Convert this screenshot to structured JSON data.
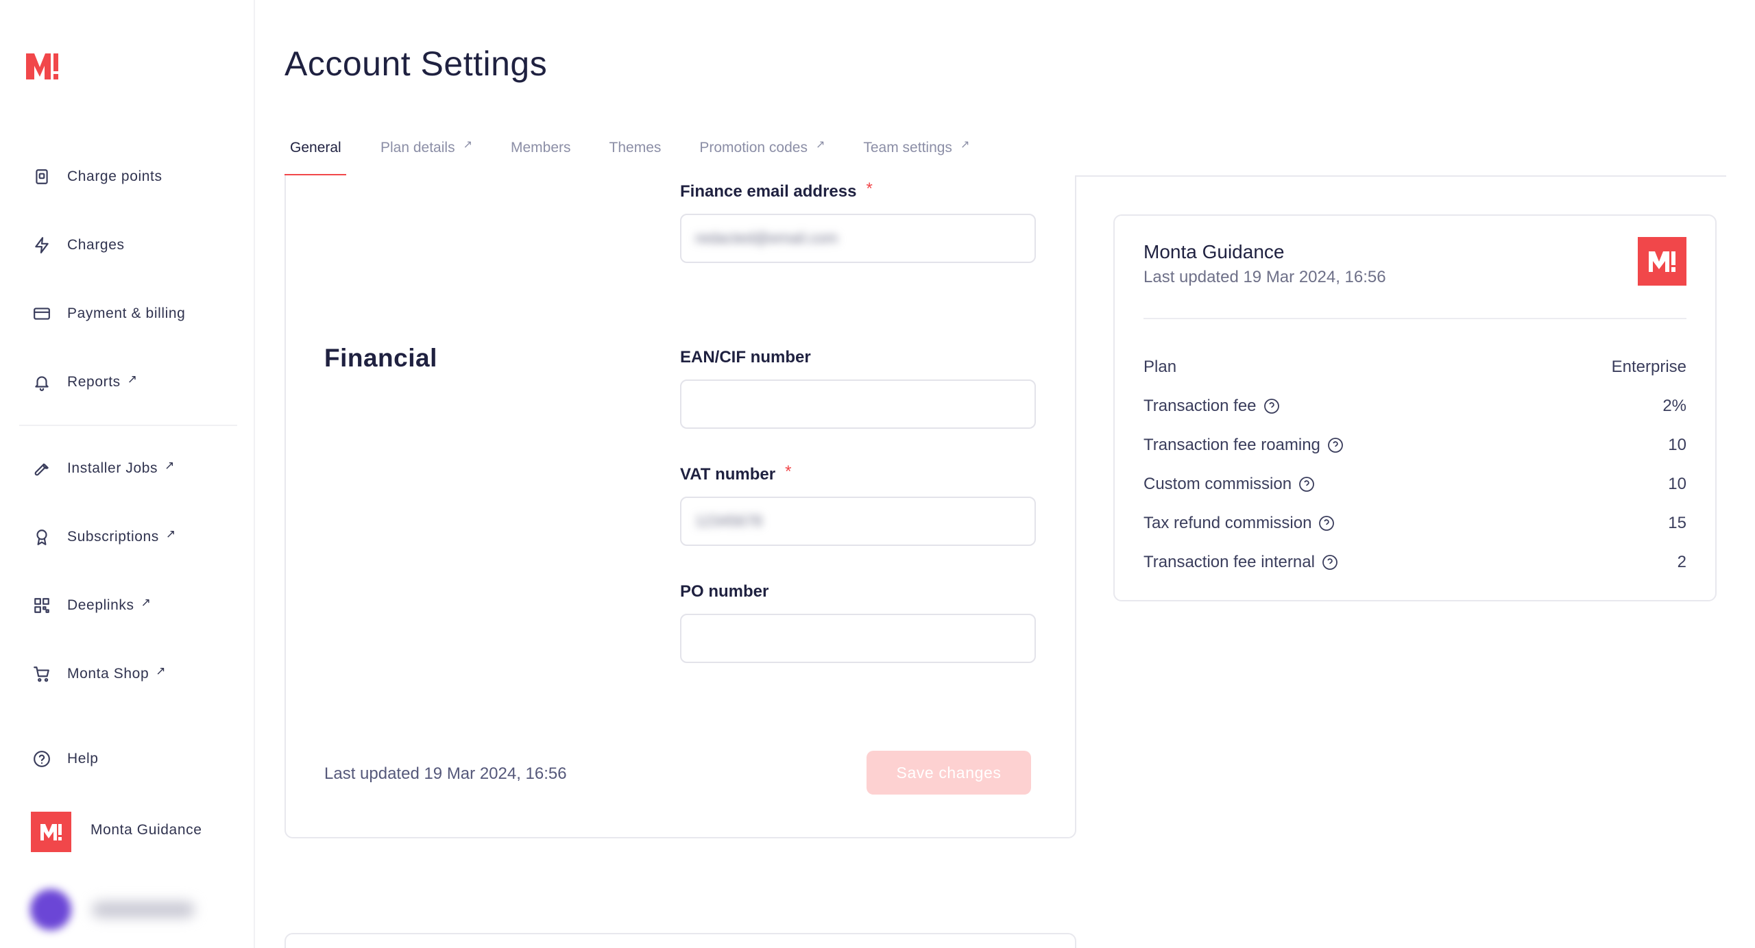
{
  "sidebar": {
    "logo": "monta-logo",
    "items": [
      {
        "label": "Charge points",
        "icon": "charge-point-icon",
        "external": false
      },
      {
        "label": "Charges",
        "icon": "lightning-icon",
        "external": false
      },
      {
        "label": "Payment & billing",
        "icon": "credit-card-icon",
        "external": false
      },
      {
        "label": "Reports",
        "icon": "bell-icon",
        "external": true
      },
      {
        "label": "Installer Jobs",
        "icon": "wrench-icon",
        "external": true
      },
      {
        "label": "Subscriptions",
        "icon": "award-icon",
        "external": true
      },
      {
        "label": "Deeplinks",
        "icon": "qr-code-icon",
        "external": true
      },
      {
        "label": "Monta Shop",
        "icon": "shopping-cart-icon",
        "external": true
      },
      {
        "label": "Help",
        "icon": "help-circle-icon",
        "external": false
      }
    ],
    "external_glyph": "↗",
    "organization": {
      "name": "Monta Guidance",
      "badge": "M!"
    }
  },
  "header": {
    "title": "Account Settings",
    "tabs": [
      {
        "label": "General",
        "active": true,
        "external": false
      },
      {
        "label": "Plan details",
        "active": false,
        "external": true
      },
      {
        "label": "Members",
        "active": false,
        "external": false
      },
      {
        "label": "Themes",
        "active": false,
        "external": false
      },
      {
        "label": "Promotion codes",
        "active": false,
        "external": true
      },
      {
        "label": "Team settings",
        "active": false,
        "external": true
      }
    ]
  },
  "financial": {
    "section_title": "Financial",
    "fields": {
      "finance_email": {
        "label": "Finance email address",
        "required": true,
        "value": "redacted@email.com"
      },
      "ean_cif": {
        "label": "EAN/CIF number",
        "required": false,
        "value": ""
      },
      "vat": {
        "label": "VAT number",
        "required": true,
        "value": "12345678"
      },
      "po": {
        "label": "PO number",
        "required": false,
        "value": ""
      }
    },
    "required_mark": "*",
    "last_updated": "Last updated 19 Mar 2024, 16:56",
    "save_label": "Save changes"
  },
  "guidance": {
    "title": "Monta Guidance",
    "subtitle": "Last updated 19 Mar 2024, 16:56",
    "badge": "M!",
    "rows": [
      {
        "label": "Plan",
        "value": "Enterprise",
        "help": false
      },
      {
        "label": "Transaction fee",
        "value": "2%",
        "help": true
      },
      {
        "label": "Transaction fee roaming",
        "value": "10",
        "help": true
      },
      {
        "label": "Custom commission",
        "value": "10",
        "help": true
      },
      {
        "label": "Tax refund commission",
        "value": "15",
        "help": true
      },
      {
        "label": "Transaction fee internal",
        "value": "2",
        "help": true
      }
    ]
  },
  "colors": {
    "accent": "#f1474a",
    "text": "#1f2140",
    "muted": "#8b8ea6",
    "button_disabled": "#fdd1d1"
  }
}
